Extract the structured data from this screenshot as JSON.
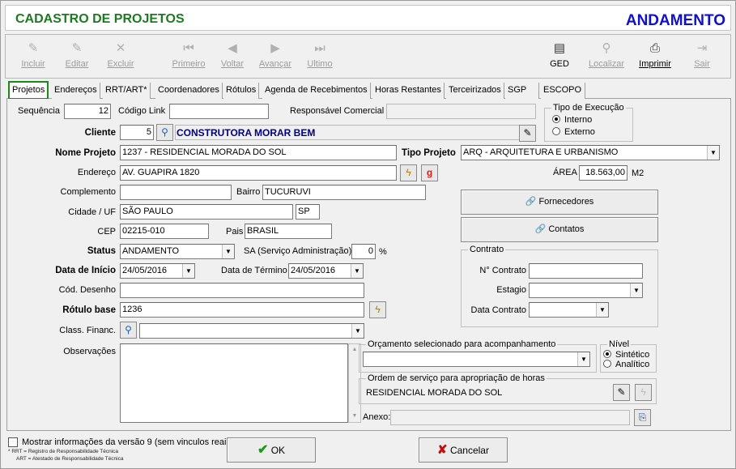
{
  "header": {
    "title": "CADASTRO DE PROJETOS",
    "status": "ANDAMENTO"
  },
  "toolbar": {
    "incluir": "Incluir",
    "editar": "Editar",
    "excluir": "Excluir",
    "primeiro": "Primeiro",
    "voltar": "Voltar",
    "avancar": "Avançar",
    "ultimo": "Ultimo",
    "ged": "GED",
    "localizar": "Localizar",
    "imprimir": "Imprimir",
    "sair": "Sair"
  },
  "tabs": [
    "Projetos",
    "Endereços",
    "RRT/ART*",
    "Coordenadores",
    "Rótulos",
    "Agenda de Recebimentos",
    "Horas Restantes",
    "Terceirizados",
    "SGP",
    "ESCOPO"
  ],
  "form": {
    "sequencia_label": "Sequência",
    "sequencia": "12",
    "codigo_link_label": "Código Link",
    "codigo_link": "",
    "resp_comercial_label": "Responsável Comercial",
    "resp_comercial": "",
    "tipo_exec_label": "Tipo de Execução",
    "interno": "Interno",
    "externo": "Externo",
    "cliente_label": "Cliente",
    "cliente_cod": "5",
    "cliente_nome": "CONSTRUTORA MORAR BEM",
    "nome_projeto_label": "Nome Projeto",
    "nome_projeto": "1237 - RESIDENCIAL MORADA DO SOL",
    "tipo_projeto_label": "Tipo Projeto",
    "tipo_projeto": "ARQ - ARQUITETURA E URBANISMO",
    "endereco_label": "Endereço",
    "endereco": "AV. GUAPIRA 1820",
    "area_label": "ÁREA",
    "area": "18.563,00",
    "area_unit": "M2",
    "complemento_label": "Complemento",
    "complemento": "",
    "bairro_label": "Bairro",
    "bairro": "TUCURUVI",
    "cidade_label": "Cidade / UF",
    "cidade": "SÃO PAULO",
    "uf": "SP",
    "cep_label": "CEP",
    "cep": "02215-010",
    "pais_label": "Pais",
    "pais": "BRASIL",
    "status_label": "Status",
    "status": "ANDAMENTO",
    "sa_label": "SA (Serviço Administração)",
    "sa": "0",
    "sa_unit": "%",
    "data_inicio_label": "Data de Início",
    "data_inicio": "24/05/2016",
    "data_termino_label": "Data de Término",
    "data_termino": "24/05/2016",
    "cod_desenho_label": "Cód. Desenho",
    "cod_desenho": "",
    "rotulo_base_label": "Rótulo base",
    "rotulo_base": "1236",
    "class_financ_label": "Class. Financ.",
    "class_financ": "",
    "observacoes_label": "Observações",
    "observacoes": "",
    "fornecedores": "Fornecedores",
    "contatos": "Contatos",
    "contrato_label": "Contrato",
    "n_contrato_label": "N° Contrato",
    "n_contrato": "",
    "estagio_label": "Estagio",
    "estagio": "",
    "data_contrato_label": "Data Contrato",
    "data_contrato": "",
    "orcamento_label": "Orçamento selecionado para acompanhamento",
    "orcamento": "",
    "nivel_label": "Nível",
    "sintetico": "Sintético",
    "analitico": "Analítico",
    "os_label": "Ordem de serviço para apropriação de horas",
    "os": "RESIDENCIAL MORADA DO SOL",
    "anexo_label": "Anexo:",
    "anexo": ""
  },
  "footer": {
    "mostrar": "Mostrar informações da versão 9 (sem vinculos reais)",
    "rrt_note": "* RRT = Registro de Responsabilidade Técnica",
    "art_note": "ART = Atestado de Responsabilidade Técnica",
    "ok": "OK",
    "cancelar": "Cancelar"
  },
  "colors": {
    "title": "#1e7a22",
    "status": "#1010c8",
    "active_tab_border": "#1b8a1b",
    "cliente_nome": "#000080"
  }
}
